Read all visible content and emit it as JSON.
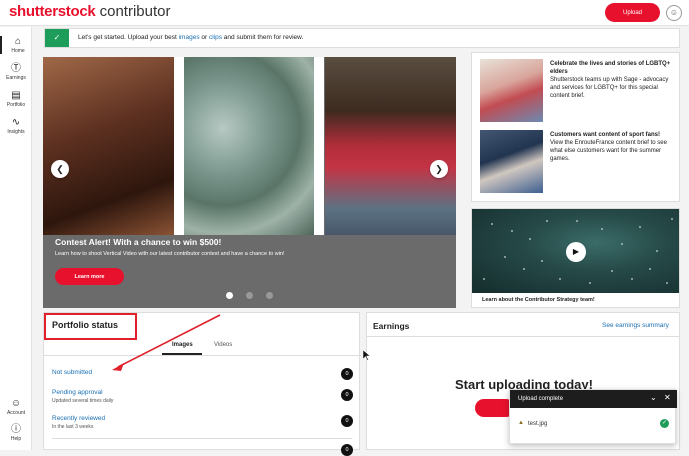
{
  "header": {
    "logo_brand": "shutterstock",
    "logo_product": "contributor",
    "upload_label": "Upload",
    "avatar_icon": "user-icon"
  },
  "sidebar": {
    "items": [
      {
        "label": "Home",
        "icon": "home-icon",
        "active": true
      },
      {
        "label": "Earnings",
        "icon": "dollar-icon"
      },
      {
        "label": "Portfolio",
        "icon": "briefcase-icon"
      },
      {
        "label": "Insights",
        "icon": "insights-icon"
      }
    ],
    "bottom": [
      {
        "label": "Account",
        "icon": "account-icon"
      },
      {
        "label": "Help",
        "icon": "help-icon"
      }
    ]
  },
  "banner": {
    "text_before": "Let's get started. Upload your best ",
    "link_images": "images",
    "text_mid": " or ",
    "link_clips": "clips",
    "text_after": " and submit them for review."
  },
  "carousel": {
    "title": "Contest Alert! With a chance to win $500!",
    "description": "Learn how to shoot Vertical Video with our latest contributor contest and have a chance to win!",
    "button": "Learn more",
    "slide_count": 3,
    "active_slide": 1
  },
  "promos": [
    {
      "title": "Celebrate the lives and stories of LGBTQ+ elders",
      "body": "Shutterstock teams up with Sage - advocacy and services for LGBTQ+ for this special content brief."
    },
    {
      "title": "Customers want content of sport fans!",
      "body": "View the EnrouteFrance content brief to see what else customers want for the summer games."
    }
  ],
  "video": {
    "caption": "Learn about the Contributor Strategy team!"
  },
  "portfolio_status": {
    "title": "Portfolio status",
    "tabs": [
      "Images",
      "Videos"
    ],
    "rows": [
      {
        "label": "Not submitted",
        "sub": "",
        "count": "0"
      },
      {
        "label": "Pending approval",
        "sub": "Updated several times daily",
        "count": "0"
      },
      {
        "label": "Recently reviewed",
        "sub": "In the last 3 weeks",
        "count": "0"
      },
      {
        "label": "",
        "sub": "",
        "count": "0"
      }
    ]
  },
  "earnings": {
    "title": "Earnings",
    "link": "See earnings summary",
    "headline": "Start uploading today!"
  },
  "toast": {
    "title": "Upload complete",
    "file": "test.jpg"
  },
  "colors": {
    "brand_red": "#e8112d",
    "success_green": "#1e9c5a",
    "link_blue": "#1a6fb3"
  }
}
